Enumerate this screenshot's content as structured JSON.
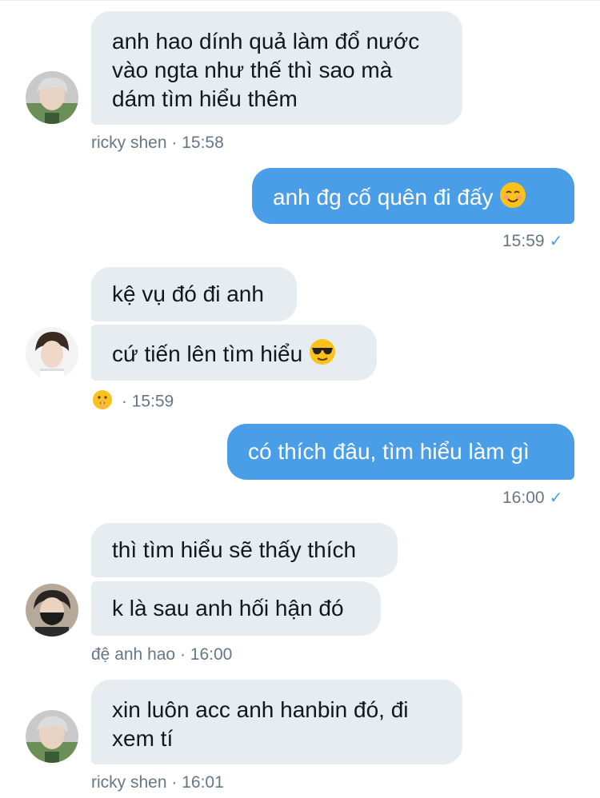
{
  "messages": [
    {
      "id": "m1",
      "lines": [
        "anh hao dính quả làm đổ nước",
        "vào ngta như thế thì sao mà",
        "dám tìm hiểu thêm"
      ]
    },
    {
      "id": "m1_meta",
      "sender": "ricky shen",
      "time": "15:58",
      "separator": "·"
    },
    {
      "id": "m2",
      "text": "anh đg cố quên đi đấy",
      "emoji": "smiling-blush-emoji"
    },
    {
      "id": "m2_meta",
      "time": "15:59",
      "status_icon": "check-icon"
    },
    {
      "id": "m3",
      "text": "kệ vụ đó đi anh"
    },
    {
      "id": "m4",
      "text": "cứ tiến lên tìm hiểu",
      "emoji": "sunglasses-emoji"
    },
    {
      "id": "m4_meta",
      "reaction_icon": "shushing-face-emoji",
      "time": "15:59",
      "separator": "·"
    },
    {
      "id": "m5",
      "text": "có thích đâu, tìm hiểu làm gì"
    },
    {
      "id": "m5_meta",
      "time": "16:00",
      "status_icon": "check-icon"
    },
    {
      "id": "m6",
      "text": "thì tìm hiểu sẽ thấy thích"
    },
    {
      "id": "m7",
      "text": "k là sau anh hối hận đó"
    },
    {
      "id": "m7_meta",
      "sender": "đệ anh hao",
      "time": "16:00",
      "separator": "·"
    },
    {
      "id": "m8",
      "lines": [
        "xin luôn acc anh hanbin đó, đi",
        "xem tí"
      ]
    },
    {
      "id": "m8_meta",
      "sender": "ricky shen",
      "time": "16:01",
      "separator": "·"
    }
  ],
  "colors": {
    "incoming_bubble": "#e6ecf0",
    "outgoing_bubble": "#4a9ee8",
    "meta_text": "#657786",
    "check": "#4a9ee8"
  }
}
